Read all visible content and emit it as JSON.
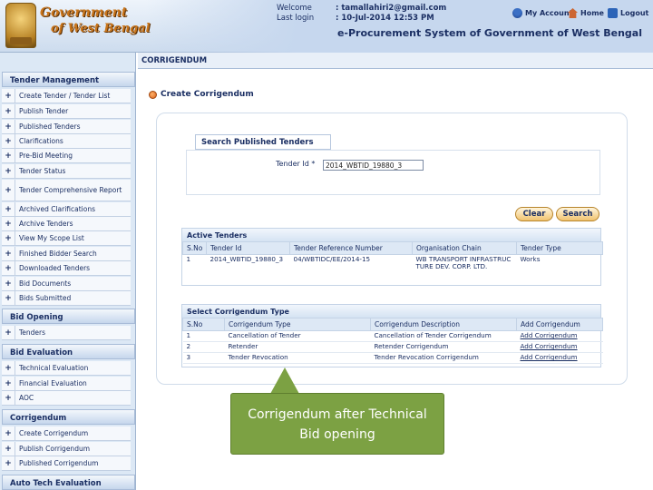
{
  "header": {
    "gov_line1": "Government",
    "gov_line2": "of West Bengal",
    "welcome_label": "Welcome",
    "welcome_value": ": tamallahiri2@gmail.com",
    "last_login_label": "Last login",
    "last_login_value": ": 10-Jul-2014 12:53 PM",
    "links": {
      "account": "My Account",
      "home": "Home",
      "logout": "Logout"
    },
    "system_name": "e-Procurement System of Government of West Bengal"
  },
  "page_title": "CORRIGENDUM",
  "sidebar": {
    "sections": [
      {
        "title": "Tender Management",
        "items": [
          "Create Tender / Tender List",
          "Publish Tender",
          "Published Tenders",
          "Clarifications",
          "Pre-Bid Meeting",
          "Tender Status",
          "Tender Comprehensive Report",
          "Archived Clarifications",
          "Archive Tenders",
          "View My Scope List",
          "Finished Bidder Search",
          "Downloaded Tenders",
          "Bid Documents",
          "Bids Submitted"
        ]
      },
      {
        "title": "Bid Opening",
        "items": [
          "Tenders"
        ]
      },
      {
        "title": "Bid Evaluation",
        "items": [
          "Technical Evaluation",
          "Financial Evaluation",
          "AOC"
        ]
      },
      {
        "title": "Corrigendum",
        "items": [
          "Create Corrigendum",
          "Publish Corrigendum",
          "Published Corrigendum"
        ]
      },
      {
        "title": "Auto Tech Evaluation",
        "items": []
      }
    ]
  },
  "main": {
    "create_title": "Create Corrigendum",
    "search_title": "Search Published Tenders",
    "tender_id_label": "Tender Id *",
    "tender_id_value": "2014_WBTID_19880_3",
    "clear_label": "Clear",
    "search_label": "Search",
    "active_tenders": {
      "title": "Active Tenders",
      "columns": [
        "S.No",
        "Tender Id",
        "Tender Reference Number",
        "Organisation Chain",
        "Tender Type"
      ],
      "rows": [
        [
          "1",
          "2014_WBTID_19880_3",
          "04/WBTIDC/EE/2014-15",
          "WB TRANSPORT INFRASTRUCTURE DEV. CORP. LTD.",
          "Works"
        ]
      ]
    },
    "corrigendum_types": {
      "title": "Select Corrigendum Type",
      "columns": [
        "S.No",
        "Corrigendum Type",
        "Corrigendum Description",
        "Add Corrigendum"
      ],
      "rows": [
        [
          "1",
          "Cancellation of Tender",
          "Cancellation of Tender Corrigendum",
          "Add Corrigendum"
        ],
        [
          "2",
          "Retender",
          "Retender Corrigendum",
          "Add Corrigendum"
        ],
        [
          "3",
          "Tender Revocation",
          "Tender Revocation Corrigendum",
          "Add Corrigendum"
        ]
      ]
    }
  },
  "callout": {
    "line1": "Corrigendum after Technical",
    "line2": "Bid opening"
  }
}
